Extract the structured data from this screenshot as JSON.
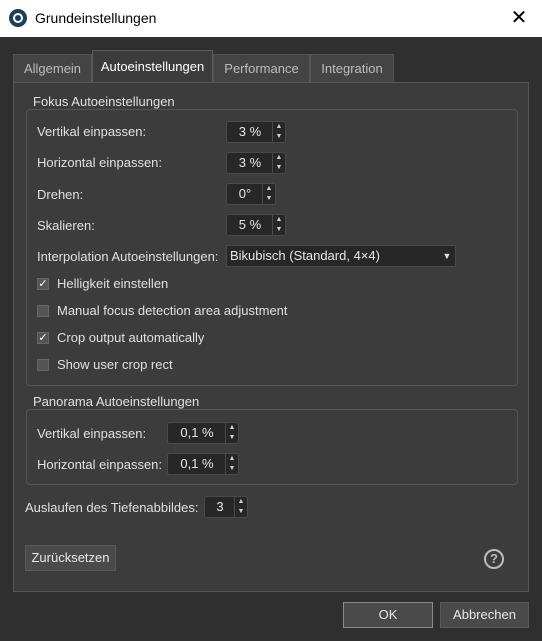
{
  "window": {
    "title": "Grundeinstellungen"
  },
  "tabs": [
    "Allgemein",
    "Autoeinstellungen",
    "Performance",
    "Integration"
  ],
  "fokus": {
    "title": "Fokus Autoeinstellungen",
    "vertikal_label": "Vertikal einpassen:",
    "vertikal_value": "3 %",
    "horizontal_label": "Horizontal einpassen:",
    "horizontal_value": "3 %",
    "drehen_label": "Drehen:",
    "drehen_value": "0°",
    "skalieren_label": "Skalieren:",
    "skalieren_value": "5 %",
    "interpolation_label": "Interpolation Autoeinstellungen:",
    "interpolation_value": "Bikubisch (Standard, 4×4)",
    "checkboxes": [
      {
        "label": "Helligkeit einstellen",
        "checked": true
      },
      {
        "label": "Manual focus detection area adjustment",
        "checked": false
      },
      {
        "label": "Crop output automatically",
        "checked": true
      },
      {
        "label": "Show user crop rect",
        "checked": false
      }
    ]
  },
  "panorama": {
    "title": "Panorama Autoeinstellungen",
    "vertikal_label": "Vertikal einpassen:",
    "vertikal_value": "0,1 %",
    "horizontal_label": "Horizontal einpassen:",
    "horizontal_value": "0,1 %"
  },
  "tiefen": {
    "label": "Auslaufen des Tiefenabbildes:",
    "value": "3"
  },
  "buttons": {
    "reset": "Zurücksetzen",
    "ok": "OK",
    "cancel": "Abbrechen",
    "help": "?"
  },
  "colors": {
    "background": "#2f2f2f",
    "panel": "#3c3c3c",
    "input": "#272727"
  }
}
